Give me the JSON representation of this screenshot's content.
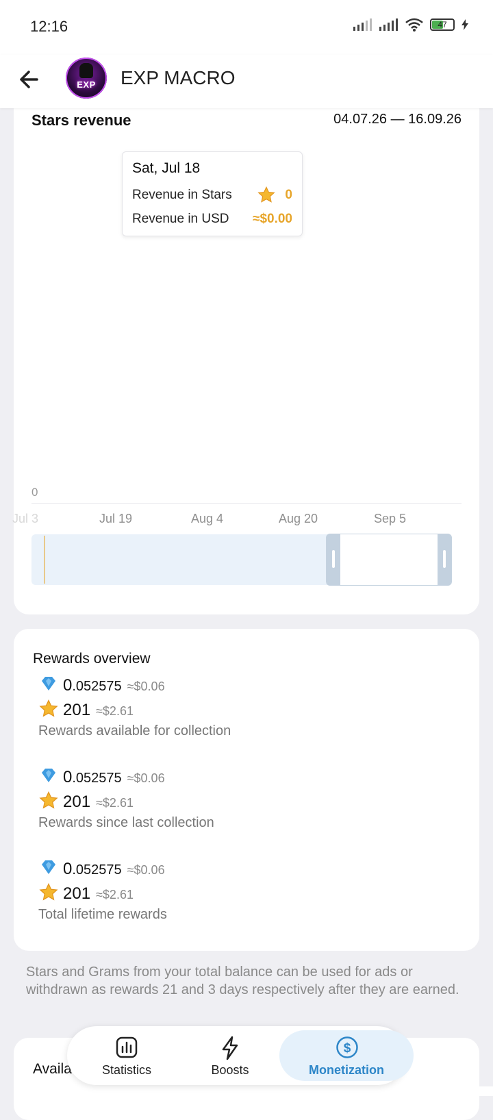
{
  "status_bar": {
    "time": "12:16",
    "battery": "47"
  },
  "header": {
    "title": "EXP MACRO",
    "avatar_text": "EXP"
  },
  "chart_data": {
    "type": "bar",
    "title": "Stars revenue",
    "date_range": "04.07.26 — 16.09.26",
    "x_tick_labels": [
      "Jul 3",
      "Jul 19",
      "Aug 4",
      "Aug 20",
      "Sep 5"
    ],
    "y_tick_labels": [
      "0"
    ],
    "series": [
      {
        "values": [
          0
        ]
      }
    ],
    "categories": [
      "Sat, Jul 18"
    ],
    "tooltip": {
      "date": "Sat, Jul 18",
      "rows": [
        {
          "label": "Revenue in Stars",
          "value": "0"
        },
        {
          "label": "Revenue in USD",
          "value": "≈$0.00"
        }
      ]
    },
    "colors": {
      "accent": "#E7A52A",
      "overview_bg": "#EAF2FA",
      "handle": "#C3D1DF"
    }
  },
  "rewards": {
    "title": "Rewards overview",
    "blocks": [
      {
        "gram_int": "0",
        "gram_dec": ".052575",
        "gram_usd": "≈$0.06",
        "stars": "201",
        "stars_usd": "≈$2.61",
        "label": "Rewards available for collection"
      },
      {
        "gram_int": "0",
        "gram_dec": ".052575",
        "gram_usd": "≈$0.06",
        "stars": "201",
        "stars_usd": "≈$2.61",
        "label": "Rewards since last collection"
      },
      {
        "gram_int": "0",
        "gram_dec": ".052575",
        "gram_usd": "≈$0.06",
        "stars": "201",
        "stars_usd": "≈$2.61",
        "label": "Total lifetime rewards"
      }
    ]
  },
  "info_text": "Stars and Grams from your total balance can be used for ads or withdrawn as rewards 21 and 3 days respectively after they are earned.",
  "partial_section_title": "Availa",
  "bottom_nav": {
    "tabs": [
      {
        "label": "Statistics",
        "icon": "bar-chart-icon"
      },
      {
        "label": "Boosts",
        "icon": "lightning-icon"
      },
      {
        "label": "Monetization",
        "icon": "dollar-circle-icon",
        "active": true
      }
    ]
  }
}
